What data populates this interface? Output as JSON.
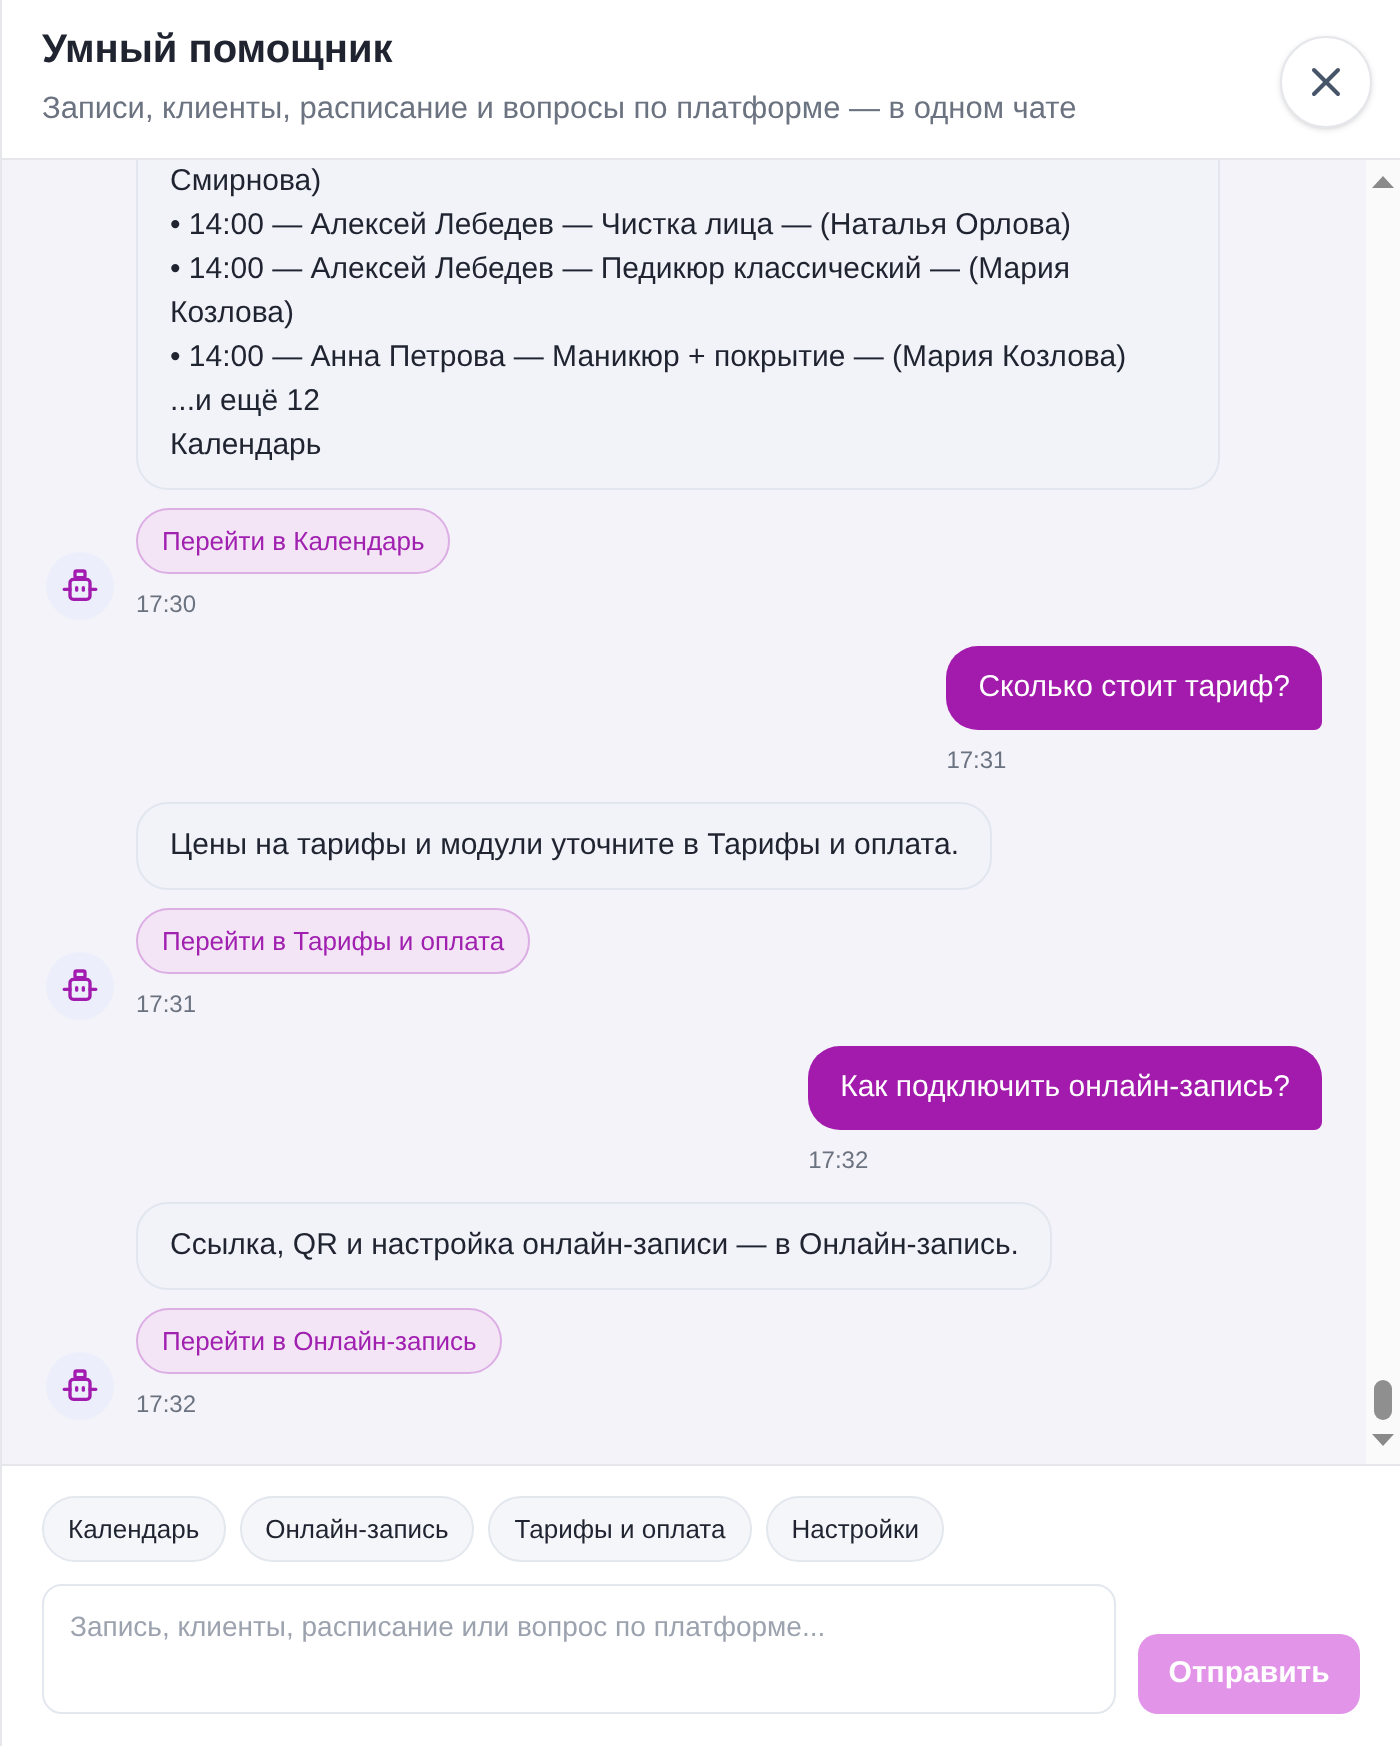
{
  "header": {
    "title": "Умный помощник",
    "subtitle": "Записи, клиенты, расписание и вопросы по платформе — в одном чате"
  },
  "messages": [
    {
      "kind": "bot",
      "cut_off_top": true,
      "lines": [
        "Смирнова)",
        "• 14:00 — Алексей Лебедев — Чистка лица — (Наталья Орлова)",
        "• 14:00 — Алексей Лебедев — Педикюр классический — (Мария Козлова)",
        "• 14:00 — Анна Петрова — Маникюр + покрытие — (Мария Козлова)",
        "...и ещё 12",
        "Календарь"
      ],
      "action": "Перейти в Календарь",
      "time": "17:30"
    },
    {
      "kind": "user",
      "text": "Сколько стоит тариф?",
      "time": "17:31"
    },
    {
      "kind": "bot",
      "cut_off_top": false,
      "lines": [
        "Цены на тарифы и модули уточните в Тарифы и оплата."
      ],
      "action": "Перейти в Тарифы и оплата",
      "time": "17:31"
    },
    {
      "kind": "user",
      "text": "Как подключить онлайн-запись?",
      "time": "17:32"
    },
    {
      "kind": "bot",
      "cut_off_top": false,
      "lines": [
        "Ссылка, QR и настройка онлайн-записи — в Онлайн-запись."
      ],
      "action": "Перейти в Онлайн-запись",
      "time": "17:32"
    }
  ],
  "quick_actions": [
    "Календарь",
    "Онлайн-запись",
    "Тарифы и оплата",
    "Настройки"
  ],
  "composer": {
    "placeholder": "Запись, клиенты, расписание или вопрос по платформе...",
    "send_button": {
      "label": "Отправить",
      "disabled": true
    }
  }
}
